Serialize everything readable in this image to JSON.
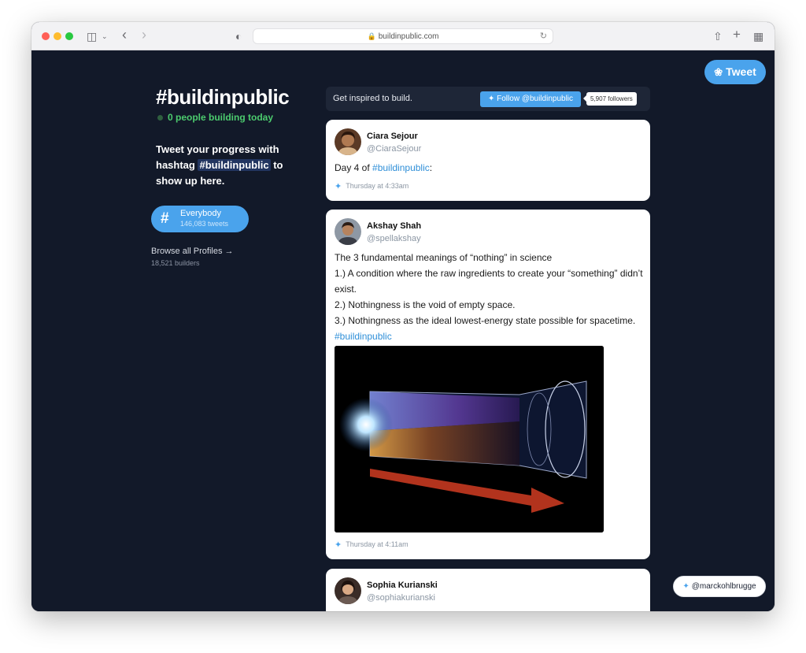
{
  "browser": {
    "url": "buildinpublic.com"
  },
  "header": {
    "tweet_button_label": "Tweet"
  },
  "sidebar": {
    "title": "#buildinpublic",
    "live_status": "0 people building today",
    "intro_before": "Tweet your progress with hashtag ",
    "intro_tag": "#buildinpublic",
    "intro_after": " to show up here.",
    "filter": {
      "label": "Everybody",
      "count": "146,083 tweets"
    },
    "browse_label": "Browse all Profiles →",
    "builders_count": "18,521 builders"
  },
  "feed": {
    "tagline": "Get inspired to build.",
    "follow_label": "Follow @buildinpublic",
    "followers": "5,907 followers",
    "tweets": [
      {
        "name": "Ciara Sejour",
        "handle": "@CiaraSejour",
        "text_before": "Day 4 of ",
        "tag": "#buildinpublic",
        "text_after": ":",
        "time": "Thursday at 4:33am"
      },
      {
        "name": "Akshay Shah",
        "handle": "@spellakshay",
        "lines": [
          "The 3 fundamental meanings of “nothing” in science",
          "1.) A condition where the raw ingredients to create your “something” didn’t exist.",
          "2.) Nothingness is the void of empty space.",
          "3.) Nothingness as the ideal lowest-energy state possible for spacetime. "
        ],
        "tag": "#buildinpublic",
        "time": "Thursday at 4:11am"
      },
      {
        "name": "Sophia Kurianski",
        "handle": "@sophiakurianski"
      }
    ]
  },
  "footer": {
    "credit": "@marckohlbrugge"
  },
  "icons": {
    "twitter": "twitter-bird-icon",
    "lock": "lock-icon",
    "hash": "hash-icon"
  },
  "colors": {
    "background": "#121929",
    "accent": "#4aa3ec",
    "live_green": "#4ccb6e",
    "link": "#2f8fd8"
  }
}
